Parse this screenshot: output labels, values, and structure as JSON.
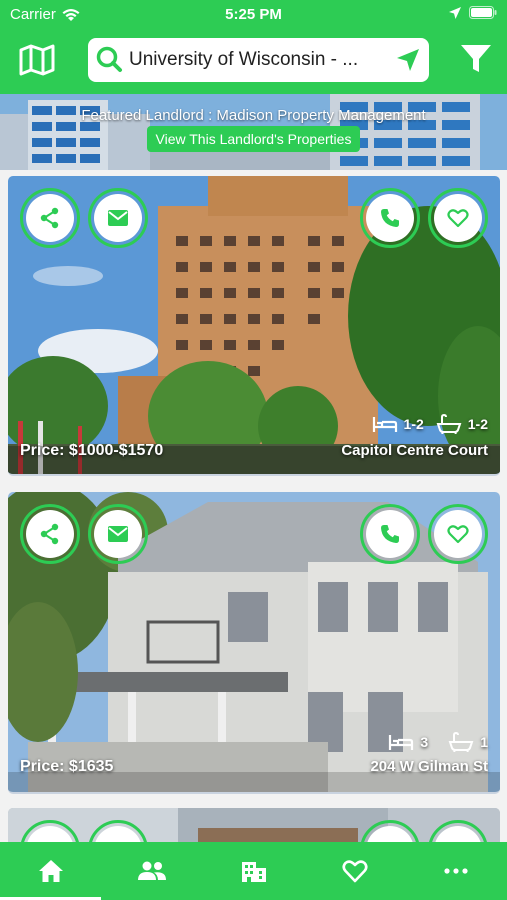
{
  "status": {
    "carrier": "Carrier",
    "time": "5:25 PM"
  },
  "header": {
    "search_value": "University of Wisconsin - ..."
  },
  "banner": {
    "text": "Featured Landlord : Madison Property Management",
    "button": "View This Landlord's Properties"
  },
  "listings": [
    {
      "price": "Price: $1000-$1570",
      "beds": "1-2",
      "baths": "1-2",
      "address": "Capitol Centre Court"
    },
    {
      "price": "Price: $1635",
      "beds": "3",
      "baths": "1",
      "address": "204 W Gilman St"
    }
  ],
  "tabs": [
    {
      "icon": "home-icon",
      "active": true
    },
    {
      "icon": "people-icon",
      "active": false
    },
    {
      "icon": "building-icon",
      "active": false
    },
    {
      "icon": "heart-icon",
      "active": false
    },
    {
      "icon": "more-icon",
      "active": false
    }
  ],
  "colors": {
    "brand": "#2dcc54"
  }
}
